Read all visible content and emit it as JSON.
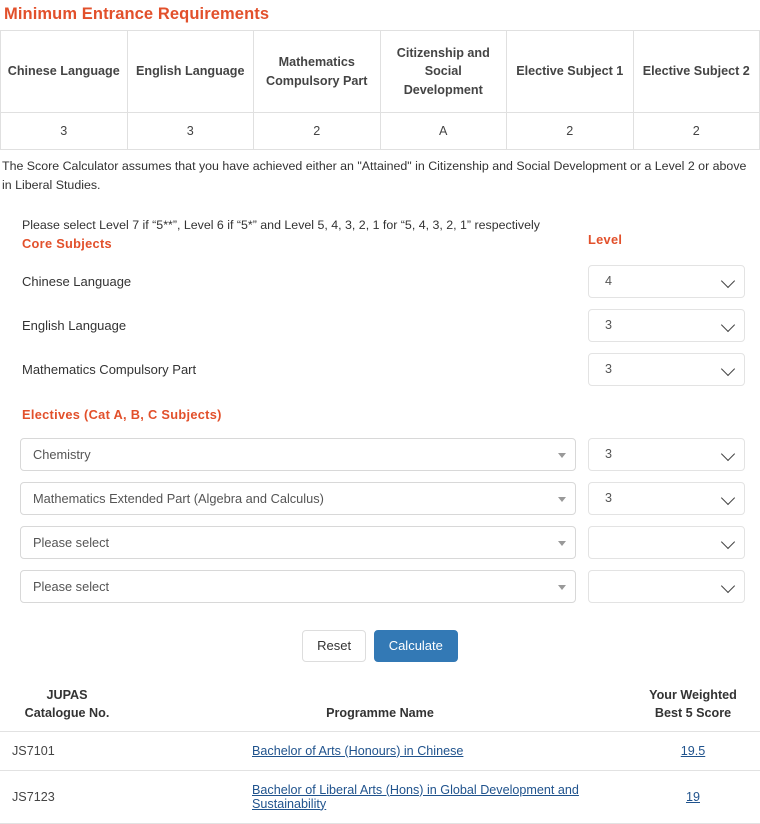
{
  "page_title": "Minimum Entrance Requirements",
  "requirements_table": {
    "headers": [
      "Chinese Language",
      "English Language",
      "Mathematics Compulsory Part",
      "Citizenship and Social Development",
      "Elective Subject 1",
      "Elective Subject 2"
    ],
    "values": [
      "3",
      "3",
      "2",
      "A",
      "2",
      "2"
    ]
  },
  "notes": {
    "assumption": "The Score Calculator assumes that you have achieved either an \"Attained\" in Citizenship and Social Development or a Level 2 or above in Liberal Studies.",
    "hint": "Please select Level 7 if “5**”, Level 6 if “5*” and Level 5, 4, 3, 2, 1 for “5, 4, 3, 2, 1” respectively"
  },
  "form": {
    "core_heading": "Core Subjects",
    "level_heading": "Level",
    "core_subjects": [
      {
        "label": "Chinese Language",
        "level": "4"
      },
      {
        "label": "English Language",
        "level": "3"
      },
      {
        "label": "Mathematics Compulsory Part",
        "level": "3"
      }
    ],
    "electives_heading": "Electives (Cat A, B, C Subjects)",
    "electives": [
      {
        "subject": "Chemistry",
        "level": "3"
      },
      {
        "subject": "Mathematics Extended Part (Algebra and Calculus)",
        "level": "3"
      },
      {
        "subject": "Please select",
        "level": ""
      },
      {
        "subject": "Please select",
        "level": ""
      }
    ],
    "buttons": {
      "reset": "Reset",
      "calculate": "Calculate"
    }
  },
  "results": {
    "headers": {
      "code": "JUPAS Catalogue No.",
      "code_line1": "JUPAS",
      "code_line2": "Catalogue No.",
      "name": "Programme Name",
      "score_line1": "Your Weighted",
      "score_line2": "Best 5 Score"
    },
    "rows": [
      {
        "code": "JS7101",
        "name": "Bachelor of Arts (Honours) in Chinese",
        "score": "19.5"
      },
      {
        "code": "JS7123",
        "name": "Bachelor of Liberal Arts (Hons) in Global Development and Sustainability",
        "score": "19"
      }
    ]
  },
  "colors": {
    "accent": "#e2502b",
    "primary_button": "#3379b5",
    "link": "#20538d"
  }
}
